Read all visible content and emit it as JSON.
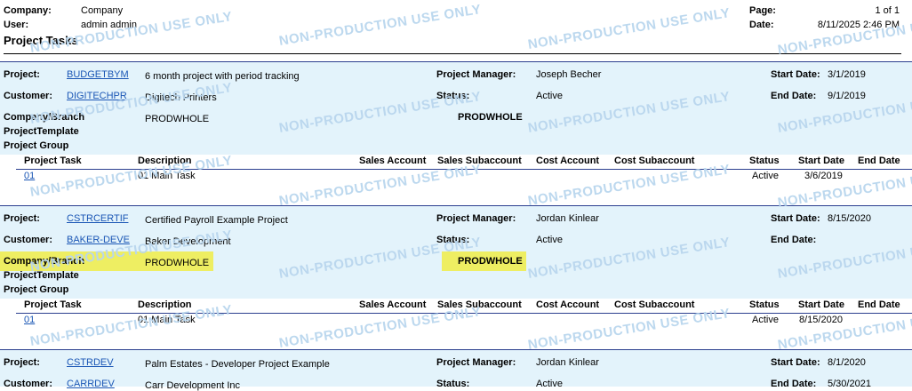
{
  "header": {
    "company_label": "Company:",
    "company_value": "Company",
    "user_label": "User:",
    "user_value": "admin admin",
    "title": "Project Tasks",
    "page_label": "Page:",
    "page_value": "1 of 1",
    "date_label": "Date:",
    "date_value": "8/11/2025 2:46 PM"
  },
  "watermark": "NON-PRODUCTION USE ONLY",
  "labels": {
    "project": "Project:",
    "customer": "Customer:",
    "company_branch": "Company/Branch",
    "project_template": "ProjectTemplate",
    "project_group": "Project Group",
    "project_manager": "Project Manager:",
    "status": "Status:",
    "start_date": "Start Date:",
    "end_date": "End Date:"
  },
  "task_columns": [
    "Project Task",
    "Description",
    "Sales Account",
    "Sales Subaccount",
    "Cost Account",
    "Cost Subaccount",
    "Status",
    "Start Date",
    "End Date"
  ],
  "projects": [
    {
      "id": "BUDGETBYM",
      "description": "6 month project with period tracking",
      "customer_id": "DIGITECHPR",
      "customer_name": "Digitech Printers",
      "company_branch": "PRODWHOLE",
      "branch_right": "PRODWHOLE",
      "manager": "Joseph Becher",
      "status": "Active",
      "start_date": "3/1/2019",
      "end_date": "9/1/2019",
      "tasks": [
        {
          "task": "01",
          "description": "01 Main Task",
          "status": "Active",
          "start_date": "3/6/2019",
          "end_date": ""
        }
      ]
    },
    {
      "id": "CSTRCERTIF",
      "description": "Certified Payroll Example Project",
      "customer_id": "BAKER-DEVE",
      "customer_name": "Baker Development",
      "company_branch": "PRODWHOLE",
      "branch_right": "PRODWHOLE",
      "manager": "Jordan Kinlear",
      "status": "Active",
      "start_date": "8/15/2020",
      "end_date": "",
      "tasks": [
        {
          "task": "01",
          "description": "01 Main Task",
          "status": "Active",
          "start_date": "8/15/2020",
          "end_date": ""
        }
      ]
    },
    {
      "id": "CSTRDEV",
      "description": "Palm Estates - Developer Project Example",
      "customer_id": "CARRDEV",
      "customer_name": "Carr Development Inc",
      "manager": "Jordan Kinlear",
      "status": "Active",
      "start_date": "8/1/2020",
      "end_date": "5/30/2021"
    }
  ]
}
